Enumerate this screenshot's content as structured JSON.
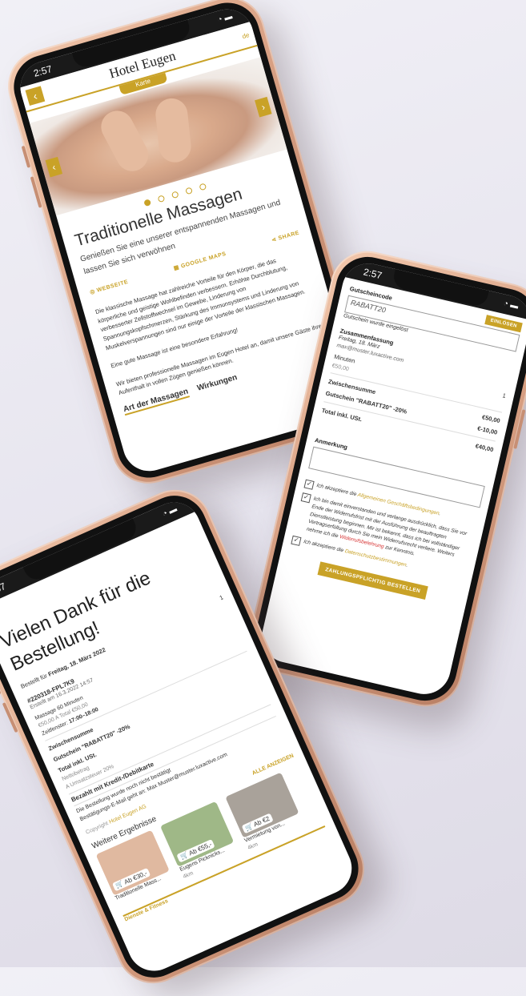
{
  "phone1": {
    "time": "2:57",
    "logo": "Hotel Eugen",
    "lang": "de",
    "menu_tab": "Karte",
    "title": "Traditionelle Massagen",
    "subtitle": "Genießen Sie eine unserer entspannenden Massagen und lassen Sie sich verwöhnen",
    "links": {
      "website": "WEBSEITE",
      "maps": "GOOGLE MAPS",
      "share": "SHARE"
    },
    "body1": "Die klassische Massage hat zahlreiche Vorteile für den Körper, die das körperliche und geistige Wohlbefinden verbessern. Erhöhte Durchblutung, verbesserter Zellstoffwechsel im Gewebe, Linderung von Spannungskopfschmerzen, Stärkung des Immunsystems und Linderung von Muskelverspannungen sind nur einige der Vorteile der klassischen Massagen.",
    "body2": "Eine gute Massage ist eine besondere Erfahrung!",
    "body3": "Wir bieten professionelle Massagen im Eugen Hotel an, damit unsere Gäste ihren Aufenthalt in vollen Zügen genießen können.",
    "tabs": [
      "Art der Massagen",
      "Wirkungen"
    ],
    "carousel": {
      "dot_count": 5,
      "active_dot": 0
    }
  },
  "phone2": {
    "time": "2:57",
    "coupon_label": "Gutscheincode",
    "coupon_value": "RABATT20",
    "redeem": "EINLÖSEN",
    "coupon_msg": "Gutschein wurde eingelöst",
    "summary_label": "Zusammenfassung",
    "date": "Freitag, 18. März",
    "email": "max@muster.luxactive.com",
    "massage_minutes": "Minuten",
    "qty": "1",
    "price_each": "€50,00",
    "subtotal_label": "Zwischensumme",
    "subtotal": "€50,00",
    "coupon_line": "Gutschein \"RABATT20\" -20%",
    "coupon_amount": "€-10,00",
    "total_label": "Total inkl. USt.",
    "total": "€40,00",
    "note_label": "Anmerkung",
    "check1_pre": "Ich akzeptiere die ",
    "check1_link": "Allgemeinen Geschäftsbedingungen",
    "check2_text": "Ich bin damit einverstanden und verlange ausdrücklich, dass Sie vor Ende der Widerrufsfrist mit der Ausführung der beauftragten Dienstleistung beginnen. Mir ist bekannt, dass ich bei vollständiger Vertragserfüllung durch Sie mein Widerrufsrecht verliere. Weiters nehme ich die ",
    "check2_link": "Widerrufsbelehrung",
    "check2_post": " zur Kenntnis.",
    "check3_pre": "Ich akzeptiere die ",
    "check3_link": "Datenschutzbestimmungen",
    "order_btn": "ZAHLUNGSPFLICHTIG BESTELLEN"
  },
  "phone3": {
    "time": "2:57",
    "title": "Vielen Dank für die Bestellung!",
    "order_for": "Bestellt für ",
    "order_date": "Freitag, 18. März 2022",
    "order_no": "#220318-FPL7K9",
    "created": "Erstellt am 16.3.2022 14:57",
    "item": "Massage 60 Minuten",
    "item_price": "€50,00 A",
    "item_total": "Total €50,00",
    "timeslot_label": "Zeitfenster:",
    "timeslot": "17:00–18:00",
    "qty": "1",
    "subtotal_label": "Zwischensumme",
    "coupon_line": "Gutschein \"RABATT20\" -20%",
    "total_label": "Total inkl. USt.",
    "net_label": "Nettobetrag",
    "vat_label": "A Umsatzsteuer 20%",
    "paid": "Bezahlt mit Kredit-/Debitkarte",
    "not_confirmed": "Die Bestellung wurde noch nicht bestätigt",
    "confirm_mail": "Bestätigungs-E-Mail geht an: Max Muster@muster.luxactive.com",
    "copyright_pre": "Copyright ",
    "copyright_name": "Hotel Eugen AG",
    "more_results": "Weitere Ergebnisse",
    "show_all": "ALLE ANZEIGEN",
    "cards": [
      {
        "price": "Ab €30,-",
        "name": "Traditionelle Mass...",
        "dist": "",
        "color": "#e0b9a0"
      },
      {
        "price": "Ab €55,-",
        "name": "Eugens Picknicks...",
        "dist": "4km",
        "color": "#9fb887"
      },
      {
        "price": "Ab €2",
        "name": "Vermietung von...",
        "dist": "4km",
        "color": "#a9a29a"
      }
    ],
    "footer": "Dienste & Fitness"
  }
}
